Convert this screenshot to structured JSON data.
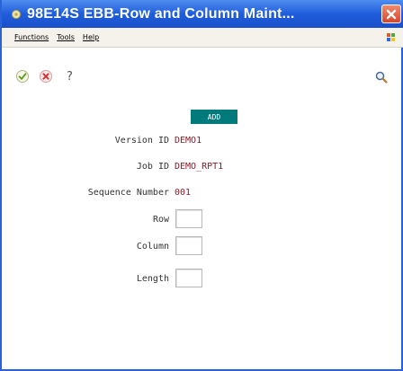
{
  "window": {
    "title": "98E14S   EBB-Row and Column Maint...",
    "accent_color": "#1f5ddc",
    "close_icon": "close-icon"
  },
  "menu": {
    "items": [
      {
        "label": "Functions"
      },
      {
        "label": "Tools"
      },
      {
        "label": "Help"
      }
    ]
  },
  "toolbar": {
    "ok_icon": "check-icon",
    "cancel_icon": "cancel-icon",
    "help_label": "?",
    "search_icon": "search-icon"
  },
  "form": {
    "mode": "ADD",
    "mode_color": "#007a7a",
    "fields": {
      "version_id": {
        "label": "Version ID",
        "value": "DEMO1"
      },
      "job_id": {
        "label": "Job ID",
        "value": "DEMO_RPT1"
      },
      "sequence_number": {
        "label": "Sequence Number",
        "value": "001"
      },
      "row": {
        "label": "Row",
        "value": ""
      },
      "column": {
        "label": "Column",
        "value": ""
      },
      "length": {
        "label": "Length",
        "value": ""
      }
    }
  }
}
